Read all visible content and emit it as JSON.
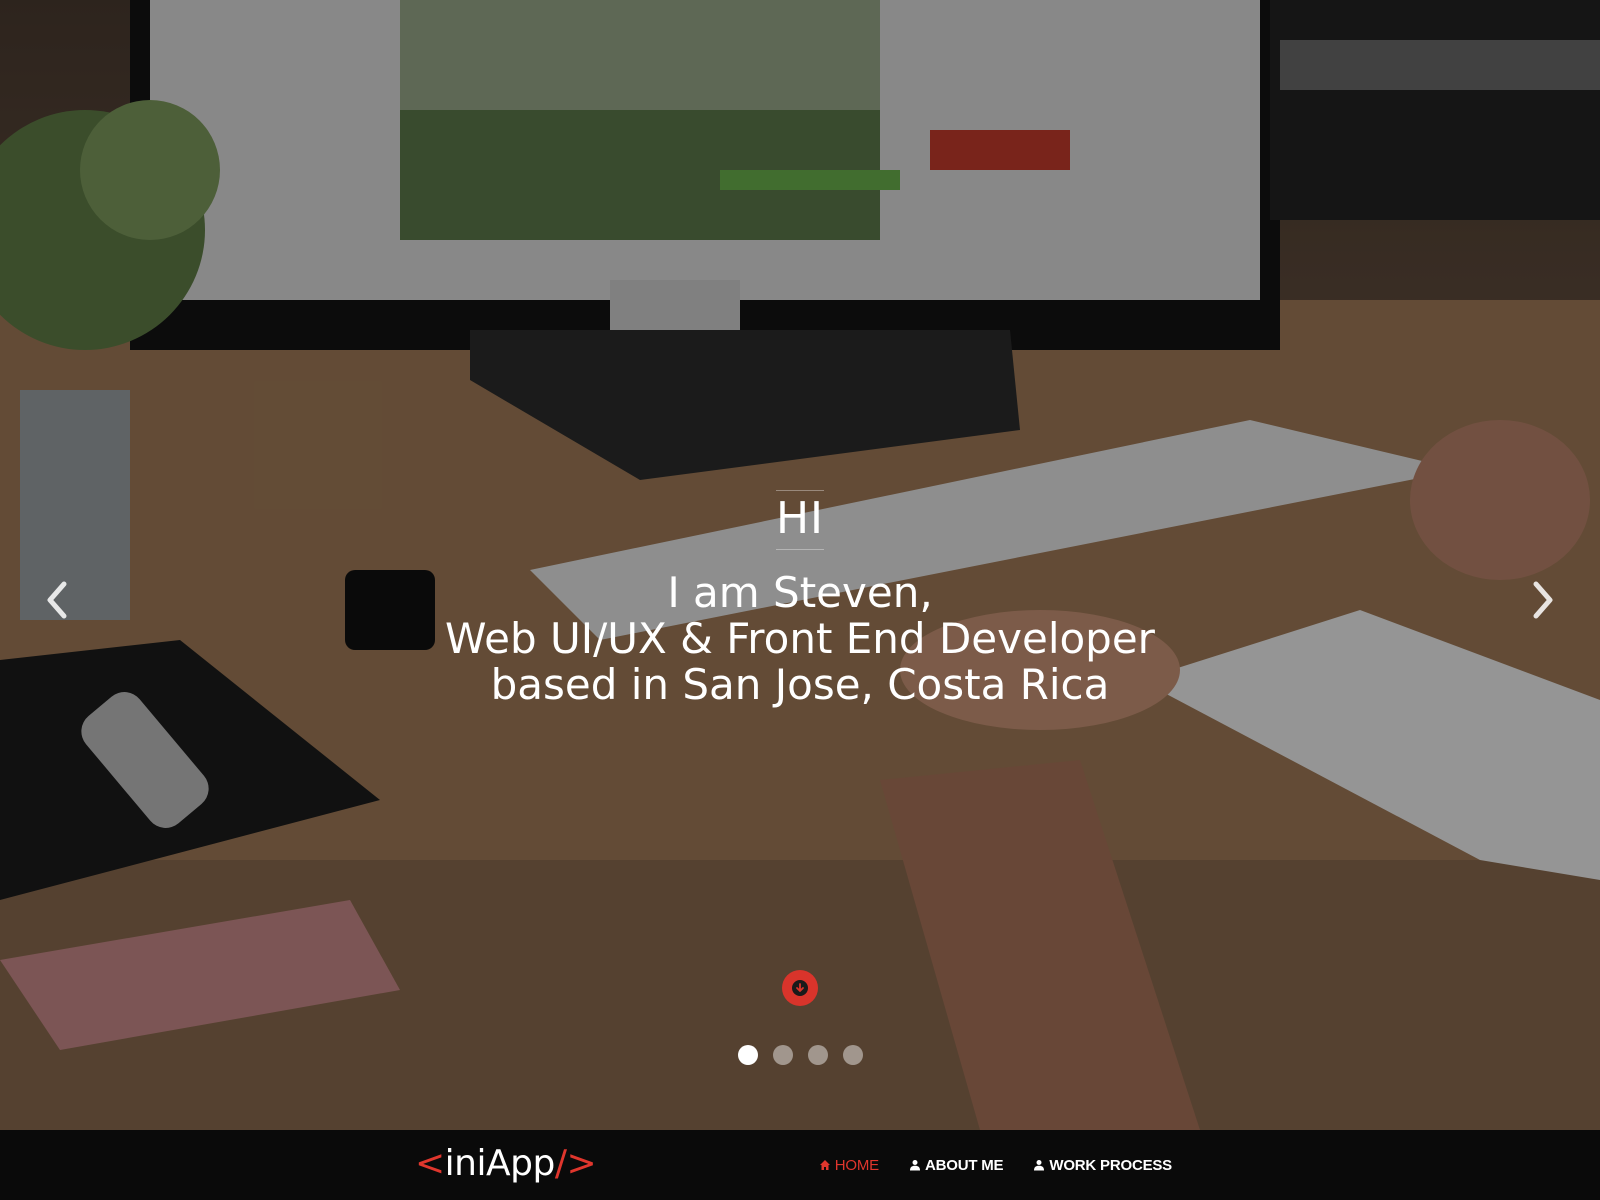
{
  "hero": {
    "greeting": "HI",
    "intro_lines": [
      "I am Steven,",
      "Web UI/UX & Front End Developer",
      "based in San Jose, Costa Rica"
    ],
    "prev_icon": "chevron-left-icon",
    "next_icon": "chevron-right-icon",
    "scroll_icon": "arrow-circle-down-icon",
    "accent_color": "#d9342b",
    "slides": {
      "count": 4,
      "active_index": 0
    }
  },
  "navbar": {
    "brand": {
      "open": "<",
      "name": "iniApp",
      "close": "/>"
    },
    "items": [
      {
        "label": "HOME",
        "icon": "home-icon",
        "active": true
      },
      {
        "label": "ABOUT ME",
        "icon": "user-icon",
        "active": false
      },
      {
        "label": "WORK PROCESS",
        "icon": "user-icon",
        "active": false
      }
    ],
    "active_color": "#e0362d",
    "background": "#0a0a0a"
  }
}
